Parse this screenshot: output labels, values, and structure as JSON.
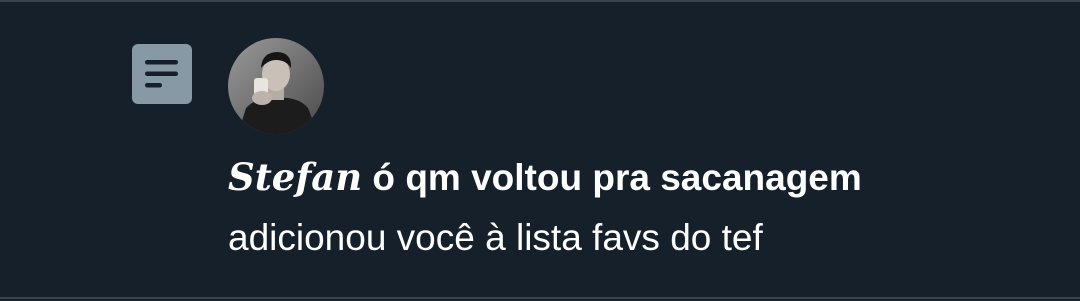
{
  "notification": {
    "icon": "list-icon",
    "avatar": "user-avatar",
    "user_name_styled": "Stefan",
    "user_name_rest": " ó qm voltou pra sacanagem",
    "action_text": "adicionou você à lista favs do tef"
  },
  "colors": {
    "background": "#15202b",
    "icon_bg": "#8899a6",
    "icon_fg": "#15202b",
    "text": "#ffffff",
    "divider": "#38444d"
  }
}
